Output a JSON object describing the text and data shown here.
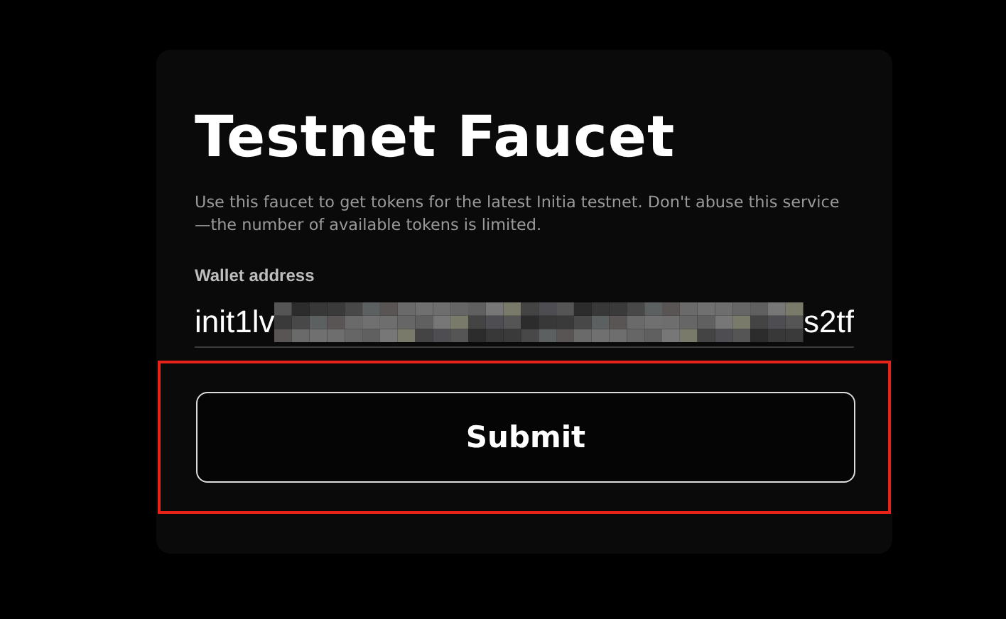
{
  "title": "Testnet Faucet",
  "description": "Use this faucet to get tokens for the latest Initia testnet. Don't abuse this service—the number of available tokens is limited.",
  "wallet_field": {
    "label": "Wallet address",
    "value_start": "init1lv",
    "value_end": "s2tf"
  },
  "submit": {
    "label": "Submit",
    "highlighted": true
  }
}
